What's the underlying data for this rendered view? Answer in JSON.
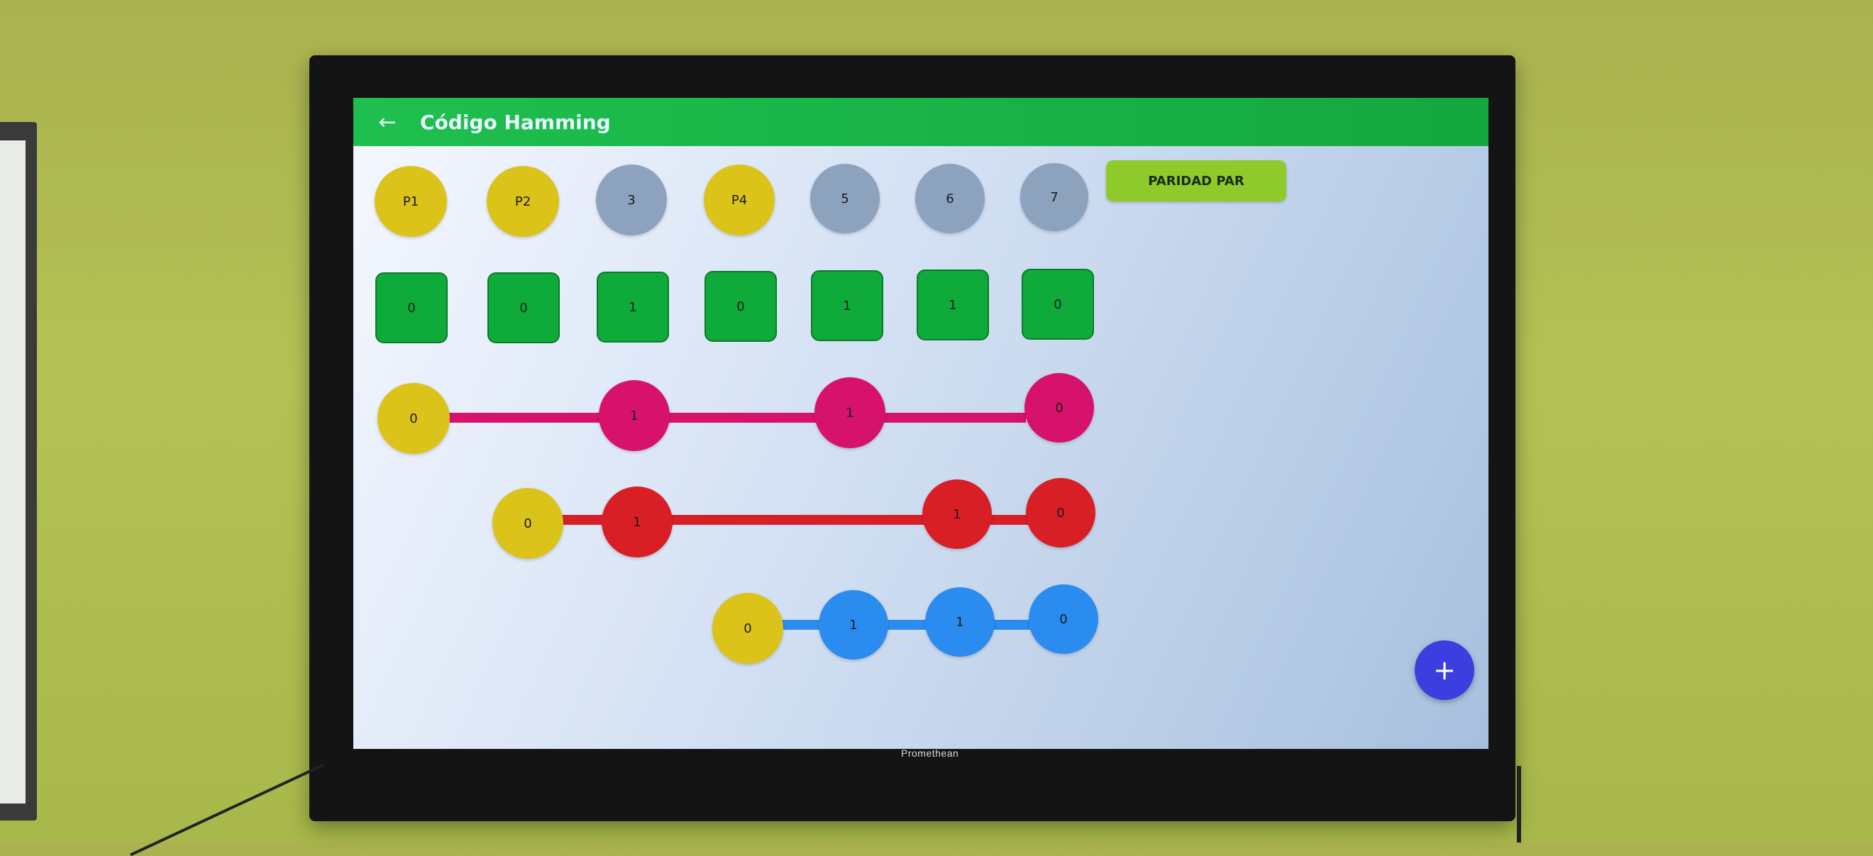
{
  "appbar": {
    "title": "Código Hamming",
    "back_icon": "arrow-left-icon"
  },
  "header_bits": [
    {
      "label": "P1",
      "color": "#dcc319"
    },
    {
      "label": "P2",
      "color": "#dcc319"
    },
    {
      "label": "3",
      "color": "#8da3bd"
    },
    {
      "label": "P4",
      "color": "#dcc319"
    },
    {
      "label": "5",
      "color": "#8da3bd"
    },
    {
      "label": "6",
      "color": "#8da3bd"
    },
    {
      "label": "7",
      "color": "#8da3bd"
    }
  ],
  "parity_button": {
    "label": "PARIDAD PAR"
  },
  "bit_values": [
    "0",
    "0",
    "1",
    "0",
    "1",
    "1",
    "0"
  ],
  "parity_rows": [
    {
      "color": "#d6126c",
      "nodes": [
        "0",
        "1",
        "1",
        "0"
      ]
    },
    {
      "color": "#d81f26",
      "nodes": [
        "0",
        "1",
        "1",
        "0"
      ]
    },
    {
      "color": "#2b8cf0",
      "nodes": [
        "0",
        "1",
        "1",
        "0"
      ]
    }
  ],
  "fab": {
    "label": "+"
  },
  "device": {
    "brand": "Promethean"
  }
}
